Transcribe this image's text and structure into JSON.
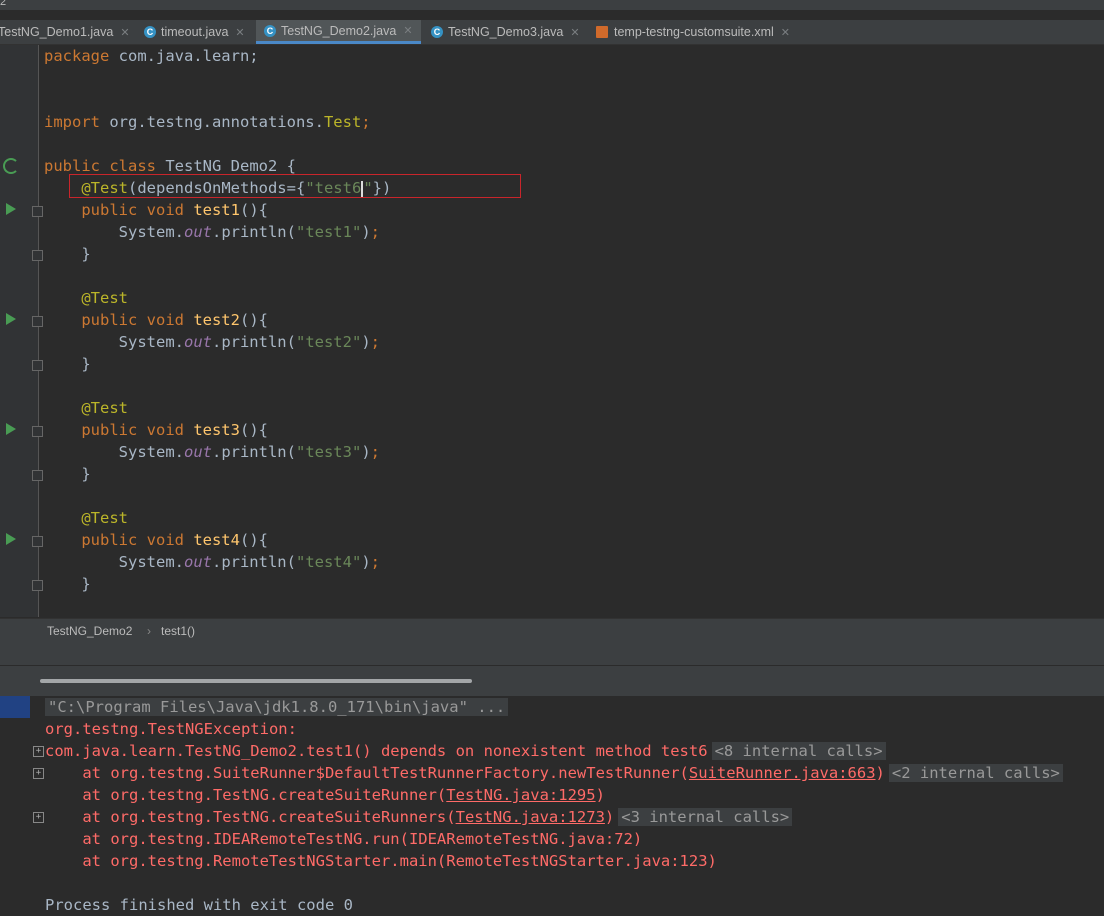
{
  "window": {
    "title_fragment": "2"
  },
  "tabs": [
    {
      "label": "TestNG_Demo1.java",
      "icon": "class-icon"
    },
    {
      "label": "timeout.java",
      "icon": "class-icon"
    },
    {
      "label": "TestNG_Demo2.java",
      "icon": "class-icon",
      "active": true
    },
    {
      "label": "TestNG_Demo3.java",
      "icon": "class-icon"
    },
    {
      "label": "temp-testng-customsuite.xml",
      "icon": "xml-file-icon"
    }
  ],
  "editor": {
    "lines": [
      {
        "parts": [
          [
            "kw",
            "package "
          ],
          [
            "normal",
            "com.java.learn;"
          ]
        ]
      },
      {
        "parts": []
      },
      {
        "parts": []
      },
      {
        "parts": [
          [
            "kw",
            "import "
          ],
          [
            "normal",
            "org.testng.annotations."
          ],
          [
            "ann",
            "Test"
          ],
          [
            "kw",
            ";"
          ]
        ]
      },
      {
        "parts": []
      },
      {
        "parts": [
          [
            "kw",
            "public class "
          ],
          [
            "normal",
            "TestNG_Demo2 {"
          ]
        ]
      },
      {
        "parts": [
          [
            "normal",
            "    "
          ],
          [
            "ann",
            "@Test"
          ],
          [
            "normal",
            "(dependsOnMethods={"
          ],
          [
            "str",
            "\"test6"
          ],
          [
            "caret",
            ""
          ],
          [
            "str",
            "\""
          ],
          [
            "normal",
            "})"
          ]
        ]
      },
      {
        "parts": [
          [
            "normal",
            "    "
          ],
          [
            "kw",
            "public void "
          ],
          [
            "fn",
            "test1"
          ],
          [
            "normal",
            "(){"
          ]
        ]
      },
      {
        "parts": [
          [
            "normal",
            "        System."
          ],
          [
            "fld",
            "out"
          ],
          [
            "normal",
            ".println("
          ],
          [
            "str",
            "\"test1\""
          ],
          [
            "normal",
            ")"
          ],
          [
            "kw",
            ";"
          ]
        ]
      },
      {
        "parts": [
          [
            "normal",
            "    }"
          ]
        ]
      },
      {
        "parts": []
      },
      {
        "parts": [
          [
            "normal",
            "    "
          ],
          [
            "ann",
            "@Test"
          ]
        ]
      },
      {
        "parts": [
          [
            "normal",
            "    "
          ],
          [
            "kw",
            "public void "
          ],
          [
            "fn",
            "test2"
          ],
          [
            "normal",
            "(){"
          ]
        ]
      },
      {
        "parts": [
          [
            "normal",
            "        System."
          ],
          [
            "fld",
            "out"
          ],
          [
            "normal",
            ".println("
          ],
          [
            "str",
            "\"test2\""
          ],
          [
            "normal",
            ")"
          ],
          [
            "kw",
            ";"
          ]
        ]
      },
      {
        "parts": [
          [
            "normal",
            "    }"
          ]
        ]
      },
      {
        "parts": []
      },
      {
        "parts": [
          [
            "normal",
            "    "
          ],
          [
            "ann",
            "@Test"
          ]
        ]
      },
      {
        "parts": [
          [
            "normal",
            "    "
          ],
          [
            "kw",
            "public void "
          ],
          [
            "fn",
            "test3"
          ],
          [
            "normal",
            "(){"
          ]
        ]
      },
      {
        "parts": [
          [
            "normal",
            "        System."
          ],
          [
            "fld",
            "out"
          ],
          [
            "normal",
            ".println("
          ],
          [
            "str",
            "\"test3\""
          ],
          [
            "normal",
            ")"
          ],
          [
            "kw",
            ";"
          ]
        ]
      },
      {
        "parts": [
          [
            "normal",
            "    }"
          ]
        ]
      },
      {
        "parts": []
      },
      {
        "parts": [
          [
            "normal",
            "    "
          ],
          [
            "ann",
            "@Test"
          ]
        ]
      },
      {
        "parts": [
          [
            "normal",
            "    "
          ],
          [
            "kw",
            "public void "
          ],
          [
            "fn",
            "test4"
          ],
          [
            "normal",
            "(){"
          ]
        ]
      },
      {
        "parts": [
          [
            "normal",
            "        System."
          ],
          [
            "fld",
            "out"
          ],
          [
            "normal",
            ".println("
          ],
          [
            "str",
            "\"test4\""
          ],
          [
            "normal",
            ")"
          ],
          [
            "kw",
            ";"
          ]
        ]
      },
      {
        "parts": [
          [
            "normal",
            "    }"
          ]
        ]
      }
    ]
  },
  "breadcrumbs": {
    "class": "TestNG_Demo2",
    "separator": "›",
    "method": "test1()"
  },
  "console": {
    "lines": [
      {
        "parts": [
          [
            "pillgray",
            "\"C:\\Program Files\\Java\\jdk1.8.0_171\\bin\\java\" ..."
          ]
        ]
      },
      {
        "parts": [
          [
            "err",
            "org.testng.TestNGException:"
          ]
        ]
      },
      {
        "parts": [
          [
            "err",
            "com.java.learn.TestNG_Demo2.test1() depends on nonexistent method test6"
          ],
          [
            "pill",
            "<8 internal calls>"
          ]
        ]
      },
      {
        "parts": [
          [
            "err",
            "    at org.testng.SuiteRunner$DefaultTestRunnerFactory.newTestRunner("
          ],
          [
            "link",
            "SuiteRunner.java:663"
          ],
          [
            "err",
            ")"
          ],
          [
            "pill",
            "<2 internal calls>"
          ]
        ]
      },
      {
        "parts": [
          [
            "err",
            "    at org.testng.TestNG.createSuiteRunner("
          ],
          [
            "link",
            "TestNG.java:1295"
          ],
          [
            "err",
            ")"
          ]
        ]
      },
      {
        "parts": [
          [
            "err",
            "    at org.testng.TestNG.createSuiteRunners("
          ],
          [
            "link",
            "TestNG.java:1273"
          ],
          [
            "err",
            ")"
          ],
          [
            "pill",
            "<3 internal calls>"
          ]
        ]
      },
      {
        "parts": [
          [
            "err",
            "    at org.testng.IDEARemoteTestNG.run(IDEARemoteTestNG.java:72)"
          ]
        ]
      },
      {
        "parts": [
          [
            "err",
            "    at org.testng.RemoteTestNGStarter.main(RemoteTestNGStarter.java:123)"
          ]
        ]
      },
      {
        "parts": []
      },
      {
        "parts": [
          [
            "normal",
            "Process finished with exit code 0"
          ]
        ]
      }
    ]
  },
  "colors": {
    "keyword": "#cc7832",
    "annotation": "#bbb529",
    "string": "#6a8759",
    "method": "#ffc66d",
    "field": "#9876aa",
    "error": "#ff6b68",
    "highlight_box": "#c9252b"
  }
}
